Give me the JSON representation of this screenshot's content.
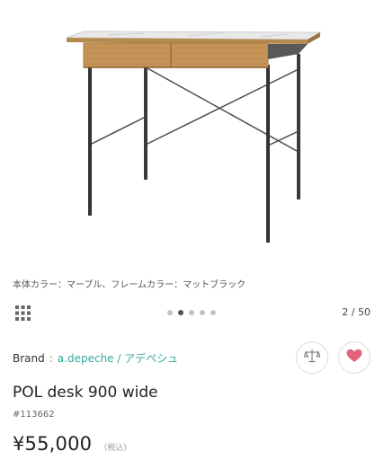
{
  "product_image": {
    "description_icon": "desk-photo"
  },
  "caption": "本体カラー：マーブル、フレームカラー：マットブラック",
  "gallery": {
    "grid_icon": "grid-icon",
    "dots": 5,
    "active_dot": 1,
    "counter": "2 / 50"
  },
  "brand": {
    "label": "Brand",
    "separator": ":",
    "name": "a.depeche / アデペシュ",
    "link_color": "#35a89a"
  },
  "actions": {
    "compare_icon": "scale-icon",
    "favorite_icon": "heart-icon",
    "favorite_color": "#e3647a"
  },
  "product": {
    "title": "POL desk 900 wide",
    "sku": "#113662",
    "price": "¥55,000",
    "tax_note": "（税込）"
  }
}
